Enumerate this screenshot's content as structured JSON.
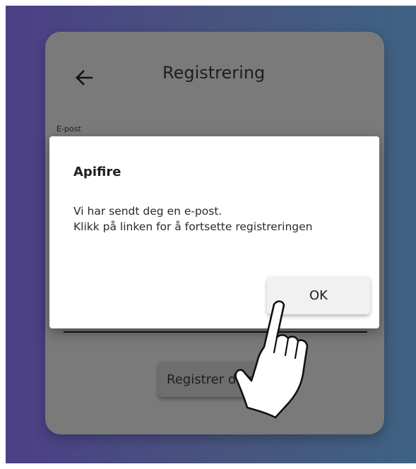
{
  "screen": {
    "title": "Registrering",
    "back_icon": "arrow-left-icon",
    "email_label": "E-post",
    "register_button": "Registrer deg",
    "colors": {
      "background_start": "#4c3f86",
      "background_end": "#3f6283",
      "card_dimmed": "#7a7a7a"
    }
  },
  "dialog": {
    "title": "Apifire",
    "message_lines": [
      "Vi har sendt deg en e-post.",
      "Klikk på linken for å fortsette registreringen"
    ],
    "ok_button": "OK"
  },
  "overlay": {
    "pointer_icon": "hand-pointer-icon"
  }
}
